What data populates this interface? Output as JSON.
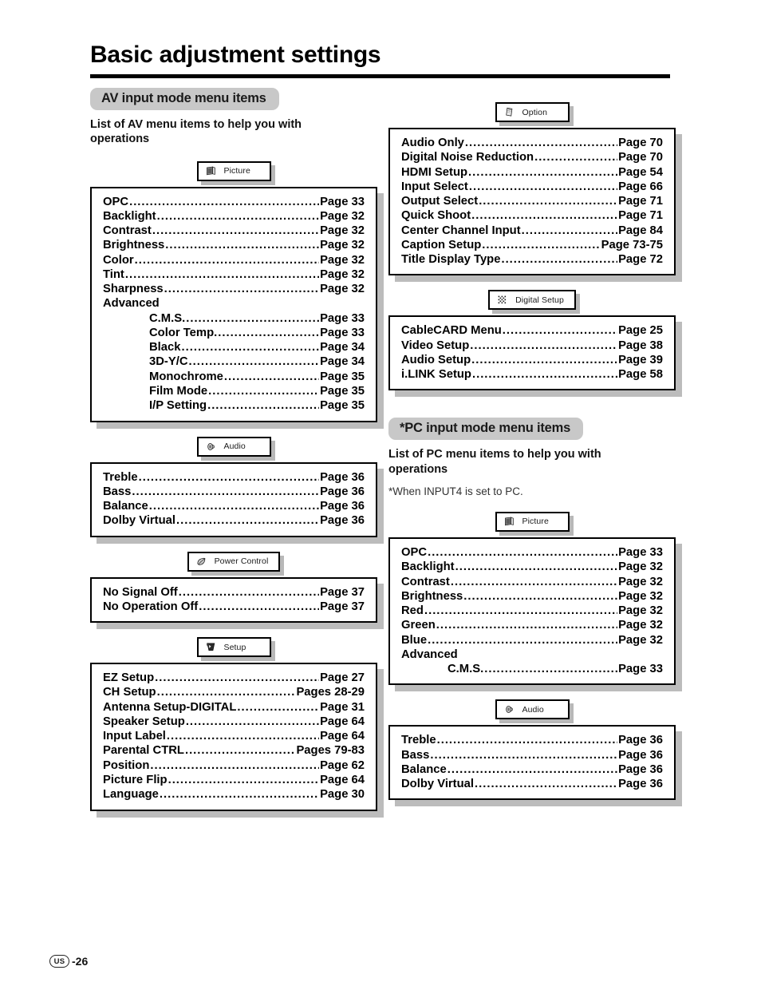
{
  "header": {
    "title": "Basic adjustment settings"
  },
  "footer": {
    "region_badge": "US",
    "page_number": "-26"
  },
  "left_column": {
    "banner": "AV input mode menu items",
    "description": "List of AV menu items to help you with operations",
    "groups": [
      {
        "tab_label": "Picture",
        "tab_icon": "picture-icon",
        "items": [
          {
            "name": "OPC",
            "page": "Page 33",
            "indent": false
          },
          {
            "name": "Backlight",
            "page": "Page 32",
            "indent": false
          },
          {
            "name": "Contrast",
            "page": "Page 32",
            "indent": false
          },
          {
            "name": "Brightness",
            "page": "Page 32",
            "indent": false
          },
          {
            "name": "Color",
            "page": "Page 32",
            "indent": false
          },
          {
            "name": "Tint",
            "page": "Page 32",
            "indent": false
          },
          {
            "name": "Sharpness",
            "page": "Page 32",
            "indent": false
          },
          {
            "name": "Advanced",
            "page": "",
            "indent": false
          },
          {
            "name": "C.M.S.",
            "page": "Page 33",
            "indent": true
          },
          {
            "name": "Color Temp.",
            "page": "Page 33",
            "indent": true
          },
          {
            "name": "Black",
            "page": "Page 34",
            "indent": true
          },
          {
            "name": "3D-Y/C",
            "page": "Page 34",
            "indent": true
          },
          {
            "name": "Monochrome",
            "page": "Page 35",
            "indent": true
          },
          {
            "name": "Film Mode",
            "page": "Page 35",
            "indent": true
          },
          {
            "name": "I/P Setting",
            "page": "Page 35",
            "indent": true
          }
        ]
      },
      {
        "tab_label": "Audio",
        "tab_icon": "speaker-icon",
        "items": [
          {
            "name": "Treble",
            "page": "Page 36",
            "indent": false
          },
          {
            "name": "Bass",
            "page": "Page 36",
            "indent": false
          },
          {
            "name": "Balance",
            "page": "Page 36",
            "indent": false
          },
          {
            "name": "Dolby Virtual",
            "page": "Page 36",
            "indent": false
          }
        ]
      },
      {
        "tab_label": "Power Control",
        "tab_icon": "leaf-icon",
        "items": [
          {
            "name": "No Signal Off",
            "page": "Page 37",
            "indent": false
          },
          {
            "name": "No Operation Off",
            "page": "Page 37",
            "indent": false
          }
        ]
      },
      {
        "tab_label": "Setup",
        "tab_icon": "hand-tool-icon",
        "items": [
          {
            "name": "EZ Setup",
            "page": "Page 27",
            "indent": false
          },
          {
            "name": "CH Setup",
            "page": "Pages 28-29",
            "indent": false
          },
          {
            "name": "Antenna Setup-DIGITAL",
            "page": "Page 31",
            "indent": false
          },
          {
            "name": "Speaker Setup",
            "page": "Page 64",
            "indent": false
          },
          {
            "name": "Input Label",
            "page": "Page 64",
            "indent": false
          },
          {
            "name": "Parental CTRL",
            "page": "Pages 79-83",
            "indent": false
          },
          {
            "name": "Position",
            "page": "Page 62",
            "indent": false
          },
          {
            "name": "Picture Flip",
            "page": "Page 64",
            "indent": false
          },
          {
            "name": "Language",
            "page": "Page 30",
            "indent": false
          }
        ]
      }
    ]
  },
  "right_column": {
    "top_groups": [
      {
        "tab_label": "Option",
        "tab_icon": "card-icon",
        "items": [
          {
            "name": "Audio Only",
            "page": "Page 70",
            "indent": false
          },
          {
            "name": "Digital Noise Reduction",
            "page": "Page 70",
            "indent": false
          },
          {
            "name": "HDMI Setup",
            "page": "Page 54",
            "indent": false
          },
          {
            "name": "Input Select",
            "page": "Page 66",
            "indent": false
          },
          {
            "name": "Output Select",
            "page": "Page 71",
            "indent": false
          },
          {
            "name": "Quick Shoot",
            "page": "Page 71",
            "indent": false
          },
          {
            "name": "Center Channel Input",
            "page": "Page 84",
            "indent": false
          },
          {
            "name": "Caption Setup",
            "page": "Page 73-75",
            "indent": false
          },
          {
            "name": "Title Display Type",
            "page": "Page 72",
            "indent": false
          }
        ]
      },
      {
        "tab_label": "Digital Setup",
        "tab_icon": "dot-grid-icon",
        "items": [
          {
            "name": "CableCARD Menu",
            "page": "Page 25",
            "indent": false
          },
          {
            "name": "Video Setup",
            "page": "Page 38",
            "indent": false
          },
          {
            "name": "Audio Setup",
            "page": "Page 39",
            "indent": false
          },
          {
            "name": "i.LINK Setup",
            "page": "Page 58",
            "indent": false
          }
        ]
      }
    ],
    "banner": "*PC input mode menu items",
    "description": "List of PC menu items to help you with operations",
    "note": "*When INPUT4 is set to PC.",
    "bottom_groups": [
      {
        "tab_label": "Picture",
        "tab_icon": "picture-icon",
        "items": [
          {
            "name": "OPC",
            "page": "Page 33",
            "indent": false
          },
          {
            "name": "Backlight",
            "page": "Page 32",
            "indent": false
          },
          {
            "name": "Contrast",
            "page": "Page 32",
            "indent": false
          },
          {
            "name": "Brightness",
            "page": "Page 32",
            "indent": false
          },
          {
            "name": "Red",
            "page": "Page 32",
            "indent": false
          },
          {
            "name": "Green",
            "page": "Page 32",
            "indent": false
          },
          {
            "name": "Blue",
            "page": "Page 32",
            "indent": false
          },
          {
            "name": "Advanced",
            "page": "",
            "indent": false
          },
          {
            "name": "C.M.S.",
            "page": "Page 33",
            "indent": true
          }
        ]
      },
      {
        "tab_label": "Audio",
        "tab_icon": "speaker-icon",
        "items": [
          {
            "name": "Treble",
            "page": "Page 36",
            "indent": false
          },
          {
            "name": "Bass",
            "page": "Page 36",
            "indent": false
          },
          {
            "name": "Balance",
            "page": "Page 36",
            "indent": false
          },
          {
            "name": "Dolby Virtual",
            "page": "Page 36",
            "indent": false
          }
        ]
      }
    ]
  },
  "colors": {
    "banner_bg": "#c8c8c8",
    "box_border": "#000000",
    "box_shadow": "#bcbcbc",
    "text": "#000000"
  }
}
